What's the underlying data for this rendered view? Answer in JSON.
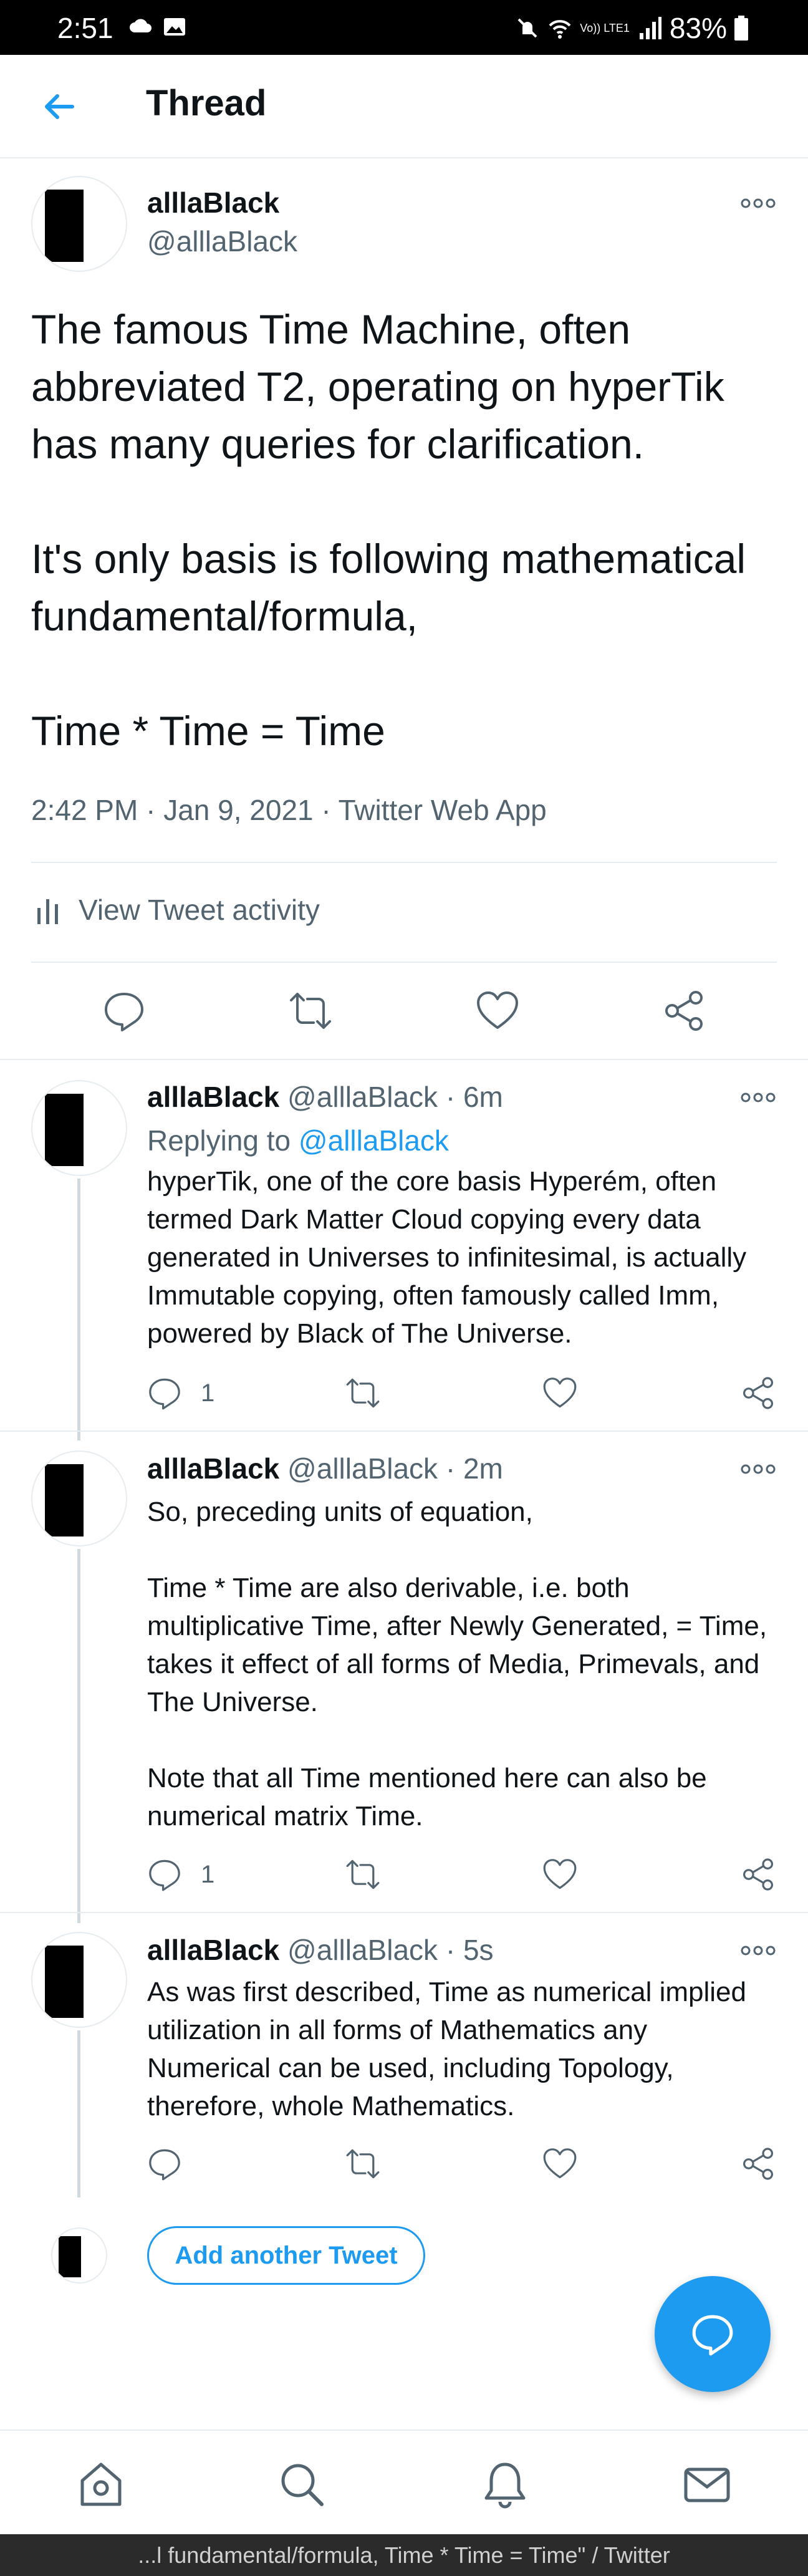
{
  "status_bar": {
    "time": "2:51",
    "network": "Vo)) LTE1",
    "battery": "83%"
  },
  "header": {
    "title": "Thread"
  },
  "main_tweet": {
    "name": "alllaBlack",
    "handle": "@alllaBlack",
    "text": "The famous Time Machine, often abbreviated T2, operating on hyperTik has many queries for clarification.\n\nIt's only basis is following mathematical fundamental/formula,\n\nTime * Time = Time",
    "meta": "2:42 PM · Jan 9, 2021 · Twitter Web App",
    "activity_label": "View Tweet activity"
  },
  "replies": [
    {
      "name": "alllaBlack",
      "handle": "@alllaBlack",
      "time": "· 6m",
      "replying_prefix": "Replying to",
      "replying_to": "@alllaBlack",
      "text": "hyperTik, one of the core basis Hyperém, often termed Dark Matter Cloud copying every data generated in Universes to infinitesimal, is actually Immutable copying, often famously called Imm, powered by Black of The Universe.",
      "reply_count": "1"
    },
    {
      "name": "alllaBlack",
      "handle": "@alllaBlack",
      "time": "· 2m",
      "text": "So, preceding units of equation,\n\nTime * Time are also derivable, i.e. both multiplicative Time, after Newly Generated, = Time, takes it effect of all forms of Media, Primevals, and The Universe.\n\nNote that all Time mentioned here can also be numerical matrix Time.",
      "reply_count": "1"
    },
    {
      "name": "alllaBlack",
      "handle": "@alllaBlack",
      "time": "· 5s",
      "text": "As was first described, Time as numerical implied utilization in all forms of Mathematics any Numerical can be used, including Topology, therefore, whole Mathematics.",
      "reply_count": ""
    }
  ],
  "add_tweet_label": "Add another Tweet",
  "bottom_nav": [
    "home-icon",
    "search-icon",
    "bell-icon",
    "mail-icon"
  ],
  "system_bar": {
    "caption": "...l fundamental/formula, Time * Time = Time\" / Twitter"
  },
  "colors": {
    "accent": "#1d9bf0",
    "text": "#0f1419",
    "secondary": "#536471",
    "divider": "#e6ecf0"
  }
}
